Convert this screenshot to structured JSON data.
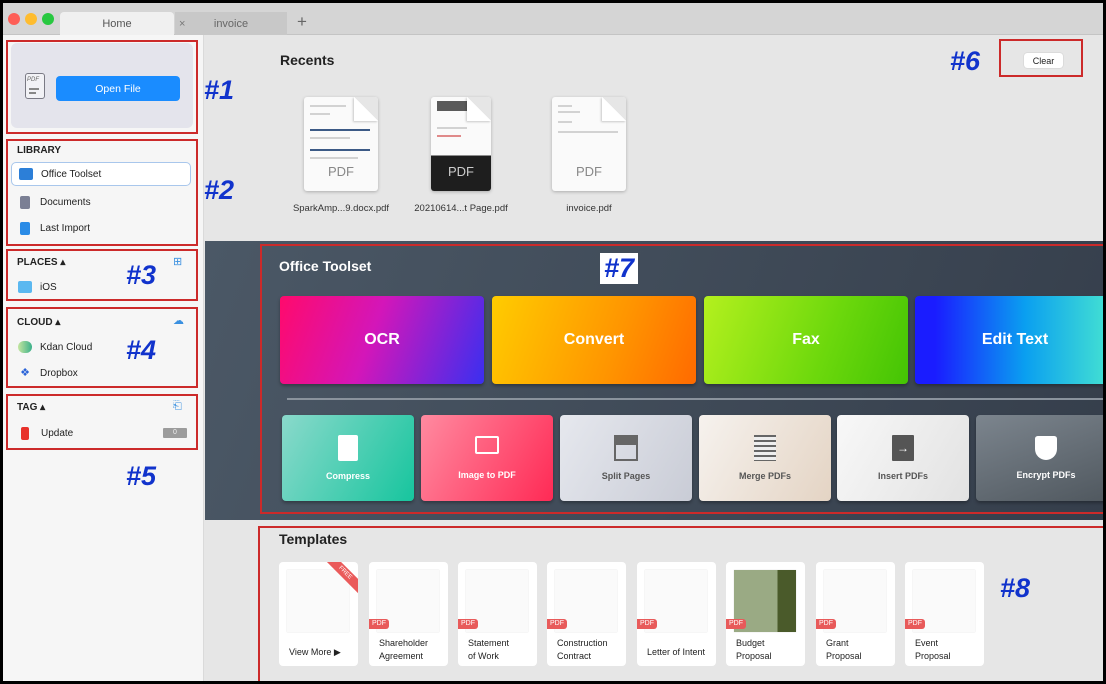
{
  "window": {
    "tabs": [
      {
        "label": "Home",
        "active": true
      },
      {
        "label": "invoice",
        "active": false
      }
    ],
    "close_tab_glyph": "×",
    "add_tab_glyph": "+"
  },
  "sidebar": {
    "open_file": {
      "icon": "pdf-file-icon",
      "icon_text": "PDF",
      "button_label": "Open File"
    },
    "library": {
      "title": "LIBRARY",
      "items": [
        {
          "label": "Office Toolset",
          "icon": "briefcase-icon",
          "selected": true
        },
        {
          "label": "Documents",
          "icon": "documents-icon",
          "selected": false
        },
        {
          "label": "Last Import",
          "icon": "import-icon",
          "selected": false
        }
      ]
    },
    "places": {
      "title": "PLACES ▴",
      "add_icon": "add-folder-icon",
      "items": [
        {
          "label": "iOS",
          "icon": "folder-icon"
        }
      ]
    },
    "cloud": {
      "title": "CLOUD ▴",
      "add_icon": "add-cloud-icon",
      "items": [
        {
          "label": "Kdan Cloud",
          "icon": "kdan-cloud-icon"
        },
        {
          "label": "Dropbox",
          "icon": "dropbox-icon"
        }
      ]
    },
    "tag": {
      "title": "TAG ▴",
      "add_icon": "add-tag-icon",
      "items": [
        {
          "label": "Update",
          "icon": "tag-icon",
          "color": "#e8312a",
          "count": "0"
        }
      ]
    }
  },
  "recents": {
    "title": "Recents",
    "clear_label": "Clear",
    "files": [
      {
        "name": "SparkAmp...9.docx.pdf",
        "type_label": "PDF"
      },
      {
        "name": "20210614...t Page.pdf",
        "type_label": "PDF"
      },
      {
        "name": "invoice.pdf",
        "type_label": "PDF"
      }
    ]
  },
  "office_toolset": {
    "title": "Office Toolset",
    "primary_tools": [
      {
        "label": "OCR",
        "colors": [
          "#ff0a6c",
          "#3a2ff0"
        ]
      },
      {
        "label": "Convert",
        "colors": [
          "#ffc400",
          "#ff7a00"
        ]
      },
      {
        "label": "Fax",
        "colors": [
          "#a8ec1a",
          "#45c905"
        ]
      },
      {
        "label": "Edit Text",
        "colors": [
          "#1a1cff",
          "#3ee0d4"
        ]
      }
    ],
    "secondary_tools": [
      {
        "label": "Compress",
        "icon": "zip-file-icon"
      },
      {
        "label": "Image to PDF",
        "icon": "image-to-pdf-icon"
      },
      {
        "label": "Split Pages",
        "icon": "split-pages-icon"
      },
      {
        "label": "Merge PDFs",
        "icon": "merge-pdfs-icon"
      },
      {
        "label": "Insert PDFs",
        "icon": "insert-pdfs-icon"
      },
      {
        "label": "Encrypt PDFs",
        "icon": "shield-icon"
      }
    ]
  },
  "templates": {
    "title": "Templates",
    "free_ribbon": "FREE",
    "badge": "PDF",
    "items": [
      {
        "label": "View More ▶",
        "is_view_more": true
      },
      {
        "label": "Shareholder Agreement",
        "line1": "Shareholder",
        "line2": "Agreement"
      },
      {
        "label": "Statement of Work",
        "line1": "Statement",
        "line2": "of Work"
      },
      {
        "label": "Construction Contract",
        "line1": "Construction",
        "line2": "Contract"
      },
      {
        "label": "Letter of Intent",
        "line1": "Letter of Intent",
        "line2": ""
      },
      {
        "label": "Budget Proposal",
        "line1": "Budget",
        "line2": "Proposal"
      },
      {
        "label": "Grant Proposal",
        "line1": "Grant",
        "line2": "Proposal"
      },
      {
        "label": "Event Proposal",
        "line1": "Event",
        "line2": "Proposal"
      }
    ]
  },
  "annotations": [
    "#1",
    "#2",
    "#3",
    "#4",
    "#5",
    "#6",
    "#7",
    "#8"
  ]
}
